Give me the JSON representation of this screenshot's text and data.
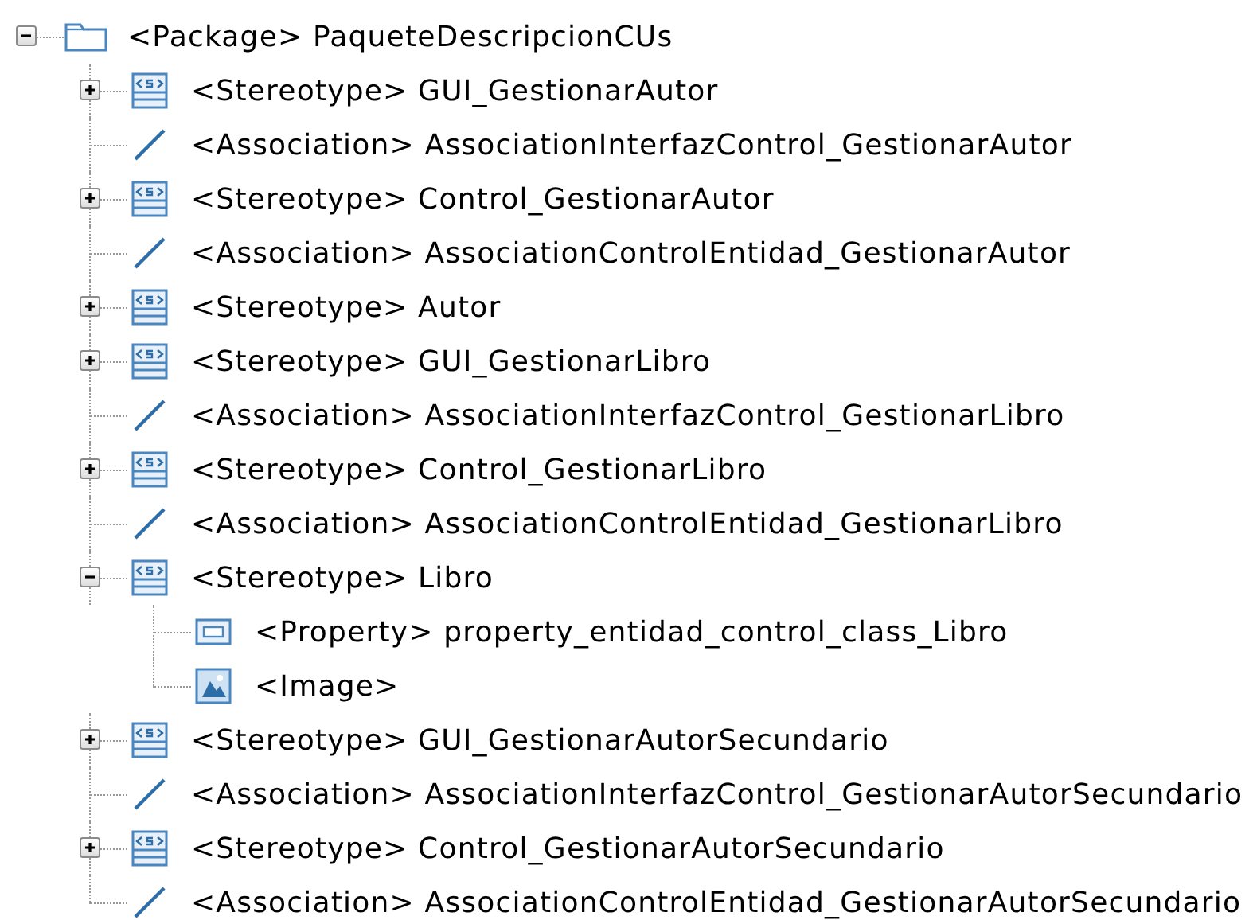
{
  "tree": {
    "kind": "package",
    "label": "<Package> PaqueteDescripcionCUs",
    "expanded": true,
    "children": [
      {
        "kind": "stereotype",
        "label": "<Stereotype> GUI_GestionarAutor",
        "expanded": false
      },
      {
        "kind": "association",
        "label": "<Association> AssociationInterfazControl_GestionarAutor"
      },
      {
        "kind": "stereotype",
        "label": "<Stereotype> Control_GestionarAutor",
        "expanded": false
      },
      {
        "kind": "association",
        "label": "<Association> AssociationControlEntidad_GestionarAutor"
      },
      {
        "kind": "stereotype",
        "label": "<Stereotype> Autor",
        "expanded": false
      },
      {
        "kind": "stereotype",
        "label": "<Stereotype> GUI_GestionarLibro",
        "expanded": false
      },
      {
        "kind": "association",
        "label": "<Association> AssociationInterfazControl_GestionarLibro"
      },
      {
        "kind": "stereotype",
        "label": "<Stereotype> Control_GestionarLibro",
        "expanded": false
      },
      {
        "kind": "association",
        "label": "<Association> AssociationControlEntidad_GestionarLibro"
      },
      {
        "kind": "stereotype",
        "label": "<Stereotype> Libro",
        "expanded": true,
        "children": [
          {
            "kind": "property",
            "label": "<Property> property_entidad_control_class_Libro"
          },
          {
            "kind": "image",
            "label": "<Image>"
          }
        ]
      },
      {
        "kind": "stereotype",
        "label": "<Stereotype> GUI_GestionarAutorSecundario",
        "expanded": false
      },
      {
        "kind": "association",
        "label": "<Association> AssociationInterfazControl_GestionarAutorSecundario"
      },
      {
        "kind": "stereotype",
        "label": "<Stereotype> Control_GestionarAutorSecundario",
        "expanded": false
      },
      {
        "kind": "association",
        "label": "<Association> AssociationControlEntidad_GestionarAutorSecundario"
      }
    ]
  }
}
